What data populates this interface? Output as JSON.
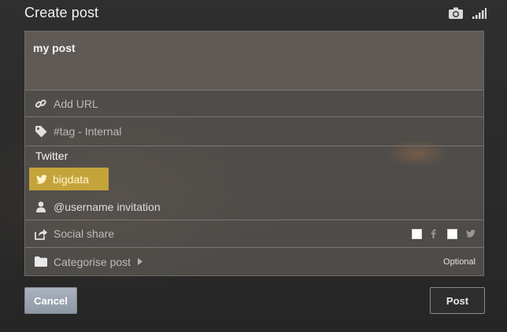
{
  "header": {
    "title": "Create post",
    "icons": [
      "camera-icon",
      "signal-icon"
    ]
  },
  "post": {
    "text": "my post"
  },
  "fields": {
    "url_placeholder": "Add URL",
    "tag_placeholder": "#tag - Internal"
  },
  "twitter": {
    "heading": "Twitter",
    "selected_tag": "bigdata",
    "username_placeholder": "@username invitation"
  },
  "social": {
    "label": "Social share",
    "networks": [
      "facebook",
      "twitter"
    ]
  },
  "category": {
    "label": "Categorise post",
    "optional_label": "Optional"
  },
  "buttons": {
    "cancel": "Cancel",
    "post": "Post"
  },
  "colors": {
    "highlight": "#c4a43a",
    "cancel_bg": "#9aa3ae"
  }
}
